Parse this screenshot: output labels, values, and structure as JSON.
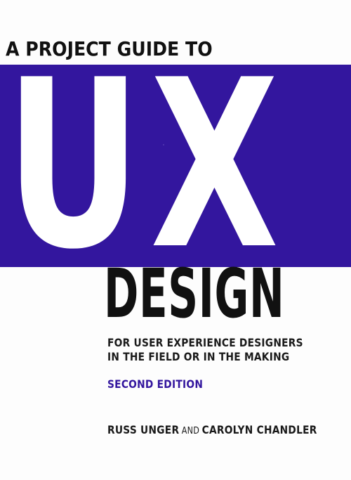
{
  "cover": {
    "eyebrow": "A PROJECT GUIDE TO",
    "letter_u": "U",
    "letter_x": "X",
    "design": "DESIGN",
    "subtitle_line1": "FOR USER EXPERIENCE DESIGNERS",
    "subtitle_line2": "IN THE FIELD OR IN THE MAKING",
    "edition": "SECOND EDITION",
    "author1": "RUSS UNGER",
    "and": "AND",
    "author2": "CAROLYN CHANDLER"
  },
  "colors": {
    "band": "#33169e",
    "text": "#111111",
    "background": "#fdfdfd"
  }
}
